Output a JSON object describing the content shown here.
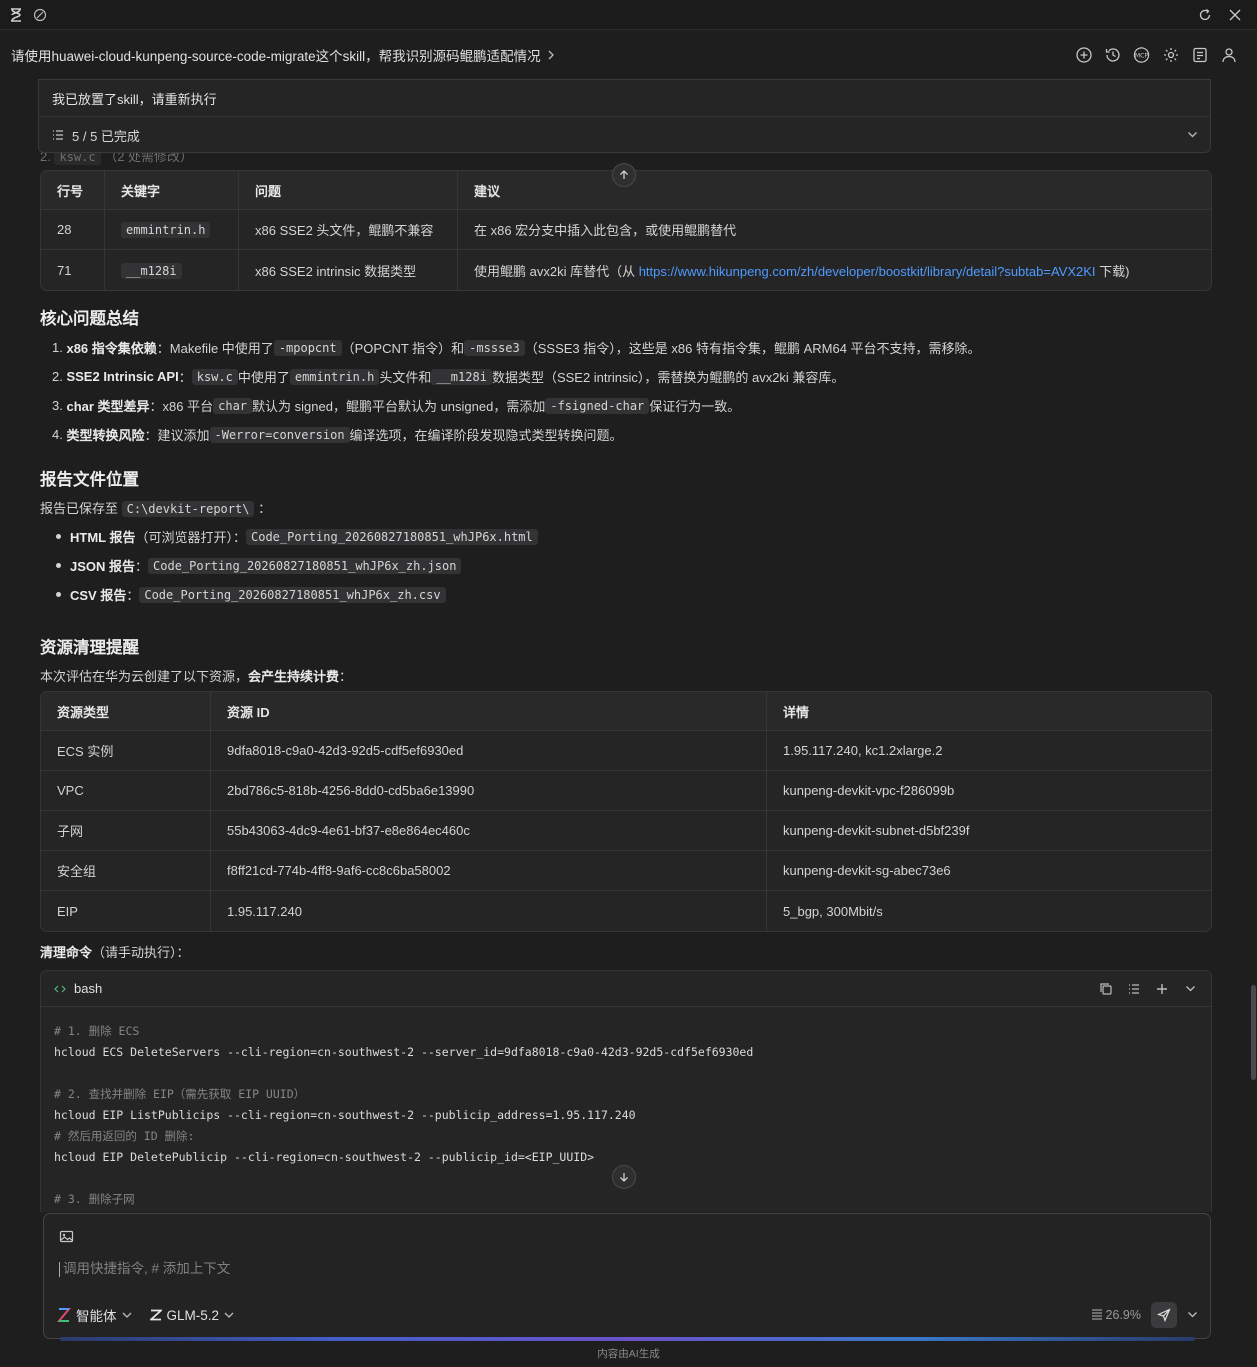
{
  "topbar": {
    "icons": [
      "hourglass-logo-icon",
      "leaf-icon",
      "refresh-icon",
      "close-icon"
    ]
  },
  "title": {
    "text": "请使用huawei-cloud-kunpeng-source-code-migrate这个skill，帮我识别源码鲲鹏适配情况"
  },
  "toolbar_icons": [
    "new-chat-icon",
    "history-icon",
    "mcp-icon",
    "settings-icon",
    "tasks-icon",
    "user-icon"
  ],
  "question_card": {
    "question": "我已放置了skill，请重新执行",
    "progress": "5 / 5 已完成"
  },
  "faded_heading": {
    "num": "2.",
    "file": "ksw.c",
    "note": "（2 处需修改）"
  },
  "issues_table": {
    "headers": [
      "行号",
      "关键字",
      "问题",
      "建议"
    ],
    "rows": [
      {
        "line": "28",
        "keyword": "emmintrin.h",
        "problem": "x86 SSE2 头文件，鲲鹏不兼容",
        "suggestion": "在 x86 宏分支中插入此包含，或使用鲲鹏替代"
      },
      {
        "line": "71",
        "keyword": "__m128i",
        "problem": "x86 SSE2 intrinsic 数据类型",
        "suggestion_prefix": "使用鲲鹏 avx2ki 库替代（从 ",
        "link": "https://www.hikunpeng.com/zh/developer/boostkit/library/detail?subtab=AVX2KI",
        "suggestion_suffix": " 下载)"
      }
    ]
  },
  "summary": {
    "heading": "核心问题总结",
    "items": [
      {
        "n": "1.",
        "bold": "x86 指令集依赖",
        "t1": "：Makefile 中使用了 ",
        "c1": "-mpopcnt",
        "t2": " （POPCNT 指令）和 ",
        "c2": "-mssse3",
        "t3": " （SSSE3 指令），这些是 x86 特有指令集，鲲鹏 ARM64 平台不支持，需移除。"
      },
      {
        "n": "2.",
        "bold": "SSE2 Intrinsic API",
        "t1": "： ",
        "c1": "ksw.c",
        "t2": " 中使用了 ",
        "c2": "emmintrin.h",
        "t3": " 头文件和 ",
        "c3": "__m128i",
        "t4": " 数据类型（SSE2 intrinsic），需替换为鲲鹏的 avx2ki 兼容库。"
      },
      {
        "n": "3.",
        "bold": "char 类型差异",
        "t1": "：x86 平台 ",
        "c1": "char",
        "t2": " 默认为 signed，鲲鹏平台默认为 unsigned，需添加 ",
        "c2": "-fsigned-char",
        "t3": " 保证行为一致。"
      },
      {
        "n": "4.",
        "bold": "类型转换风险",
        "t1": "：建议添加 ",
        "c1": "-Werror=conversion",
        "t2": " 编译选项，在编译阶段发现隐式类型转换问题。"
      }
    ]
  },
  "report": {
    "heading": "报告文件位置",
    "intro_prefix": "报告已保存至 ",
    "path": "C:\\devkit-report\\",
    "intro_suffix": " ：",
    "files": [
      {
        "bold": "HTML 报告",
        "label": "（可浏览器打开）： ",
        "file": "Code_Porting_20260827180851_whJP6x.html"
      },
      {
        "bold": "JSON 报告",
        "label": "： ",
        "file": "Code_Porting_20260827180851_whJP6x_zh.json"
      },
      {
        "bold": "CSV 报告",
        "label": "： ",
        "file": "Code_Porting_20260827180851_whJP6x_zh.csv"
      }
    ]
  },
  "cleanup": {
    "heading": "资源清理提醒",
    "intro_prefix": "本次评估在华为云创建了以下资源，",
    "intro_bold": "会产生持续计费",
    "intro_suffix": "：",
    "headers": [
      "资源类型",
      "资源 ID",
      "详情"
    ],
    "rows": [
      [
        "ECS 实例",
        "9dfa8018-c9a0-42d3-92d5-cdf5ef6930ed",
        "1.95.117.240, kc1.2xlarge.2"
      ],
      [
        "VPC",
        "2bd786c5-818b-4256-8dd0-cd5ba6e13990",
        "kunpeng-devkit-vpc-f286099b"
      ],
      [
        "子网",
        "55b43063-4dc9-4e61-bf37-e8e864ec460c",
        "kunpeng-devkit-subnet-d5bf239f"
      ],
      [
        "安全组",
        "f8ff21cd-774b-4ff8-9af6-cc8c6ba58002",
        "kunpeng-devkit-sg-abec73e6"
      ],
      [
        "EIP",
        "1.95.117.240",
        "5_bgp, 300Mbit/s"
      ]
    ],
    "cmd_bold": "清理命令",
    "cmd_rest": "（请手动执行）："
  },
  "code": {
    "lang": "bash",
    "lines": [
      {
        "t": "# 1. 删除 ECS",
        "c": true
      },
      {
        "t": "hcloud ECS DeleteServers --cli-region=cn-southwest-2 --server_id=9dfa8018-c9a0-42d3-92d5-cdf5ef6930ed",
        "c": false
      },
      {
        "t": "",
        "c": false
      },
      {
        "t": "# 2. 查找并删除 EIP（需先获取 EIP UUID）",
        "c": true
      },
      {
        "t": "hcloud EIP ListPublicips --cli-region=cn-southwest-2 --publicip_address=1.95.117.240",
        "c": false
      },
      {
        "t": "# 然后用返回的 ID 删除:",
        "c": true
      },
      {
        "t": "hcloud EIP DeletePublicip --cli-region=cn-southwest-2 --publicip_id=<EIP_UUID>",
        "c": false
      },
      {
        "t": "",
        "c": false
      },
      {
        "t": "# 3. 删除子网",
        "c": true
      }
    ]
  },
  "input": {
    "placeholder": "调用快捷指令, # 添加上下文",
    "agent": "智能体",
    "model": "GLM-5.2",
    "context_usage": "26.9%"
  },
  "footer": "内容由AI生成"
}
